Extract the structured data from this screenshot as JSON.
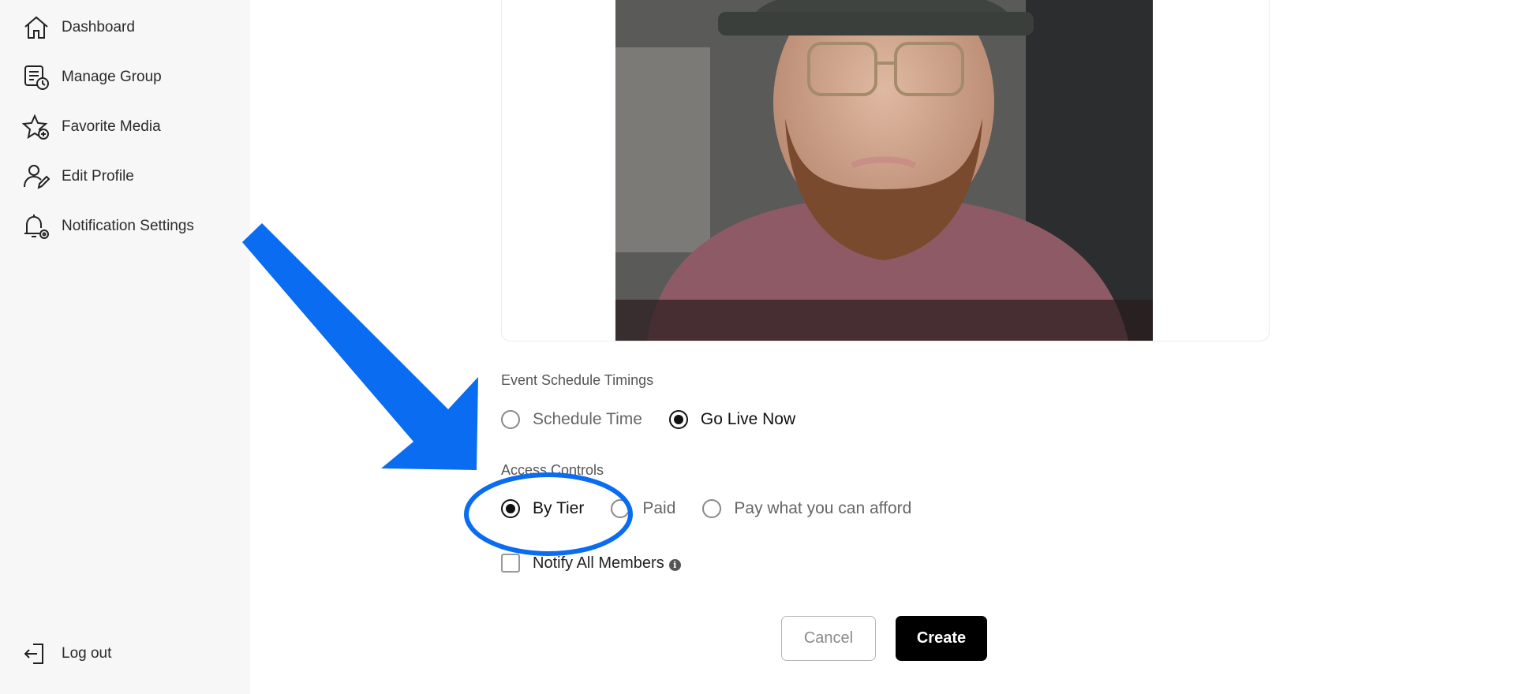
{
  "sidebar": {
    "items": [
      {
        "label": "Dashboard",
        "icon": "home-icon"
      },
      {
        "label": "Manage Group",
        "icon": "manage-group-icon"
      },
      {
        "label": "Favorite Media",
        "icon": "star-add-icon"
      },
      {
        "label": "Edit Profile",
        "icon": "user-edit-icon"
      },
      {
        "label": "Notification Settings",
        "icon": "bell-gear-icon"
      }
    ],
    "logout_label": "Log out"
  },
  "event_schedule": {
    "label": "Event Schedule Timings",
    "options": [
      "Schedule Time",
      "Go Live Now"
    ],
    "selected": "Go Live Now"
  },
  "access_controls": {
    "label": "Access Controls",
    "options": [
      "By Tier",
      "Paid",
      "Pay what you can afford"
    ],
    "selected": "By Tier"
  },
  "notify": {
    "label": "Notify All Members",
    "checked": false,
    "info_icon": "info-icon"
  },
  "buttons": {
    "cancel": "Cancel",
    "create": "Create"
  },
  "colors": {
    "annotation": "#0a6cf0",
    "create_button": "#000000"
  }
}
